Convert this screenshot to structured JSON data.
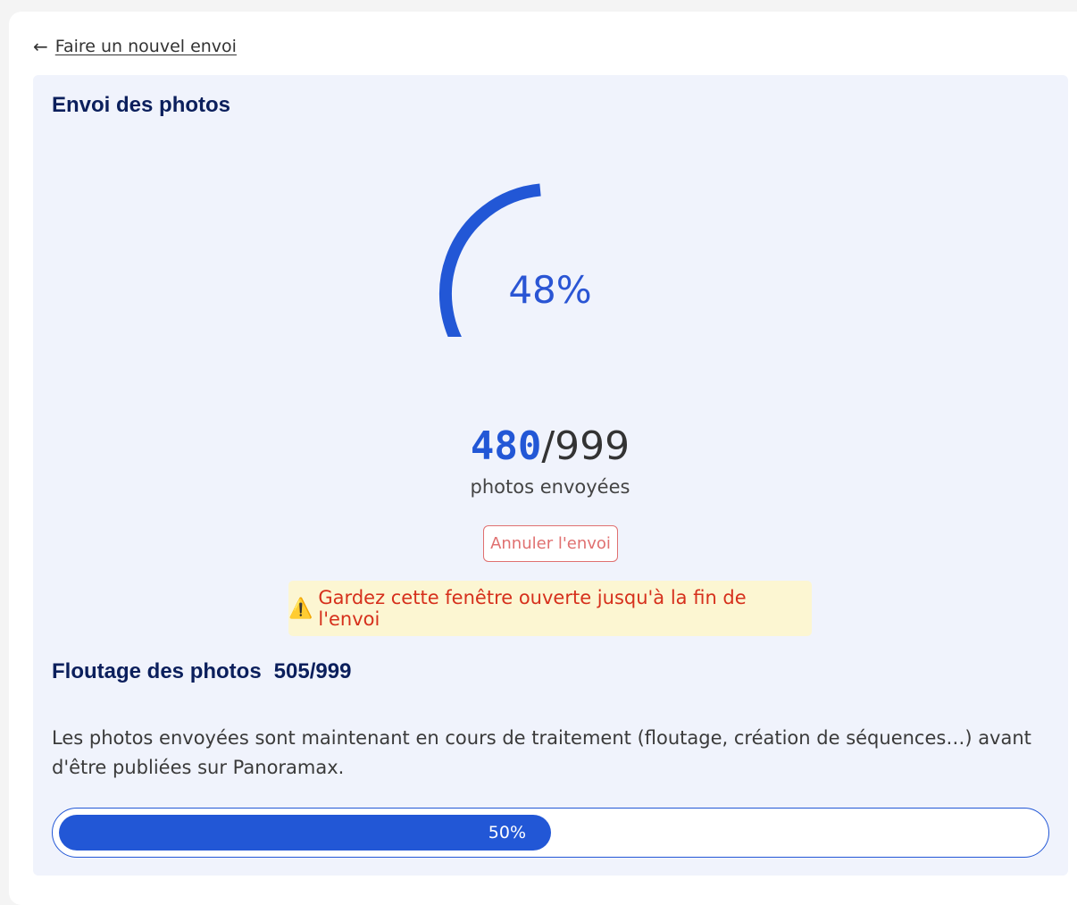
{
  "nav": {
    "back_label": "Faire un nouvel envoi"
  },
  "upload": {
    "title": "Envoi des photos",
    "percent_label": "48%",
    "percent_value": 48,
    "uploaded": "480",
    "separator": "/",
    "total": "999",
    "caption": "photos envoyées",
    "cancel_label": "Annuler l'envoi",
    "warning_text": "Gardez cette fenêtre ouverte jusqu'à la fin de l'envoi"
  },
  "blurring": {
    "title": "Floutage des photos",
    "count": "505/999",
    "description": "Les photos envoyées sont maintenant en cours de traitement (floutage, création de séquences…) avant d'être publiées sur Panoramax.",
    "progress_label": "50%",
    "progress_value": 50
  },
  "colors": {
    "accent": "#2257d6",
    "title": "#0b1f5c",
    "panel_bg": "#f0f3fc",
    "warning_bg": "#fcf6d2",
    "warning_text": "#d6301c",
    "cancel": "#e07070"
  },
  "icons": {
    "back": "arrow-left-icon",
    "warning": "warning-icon"
  }
}
